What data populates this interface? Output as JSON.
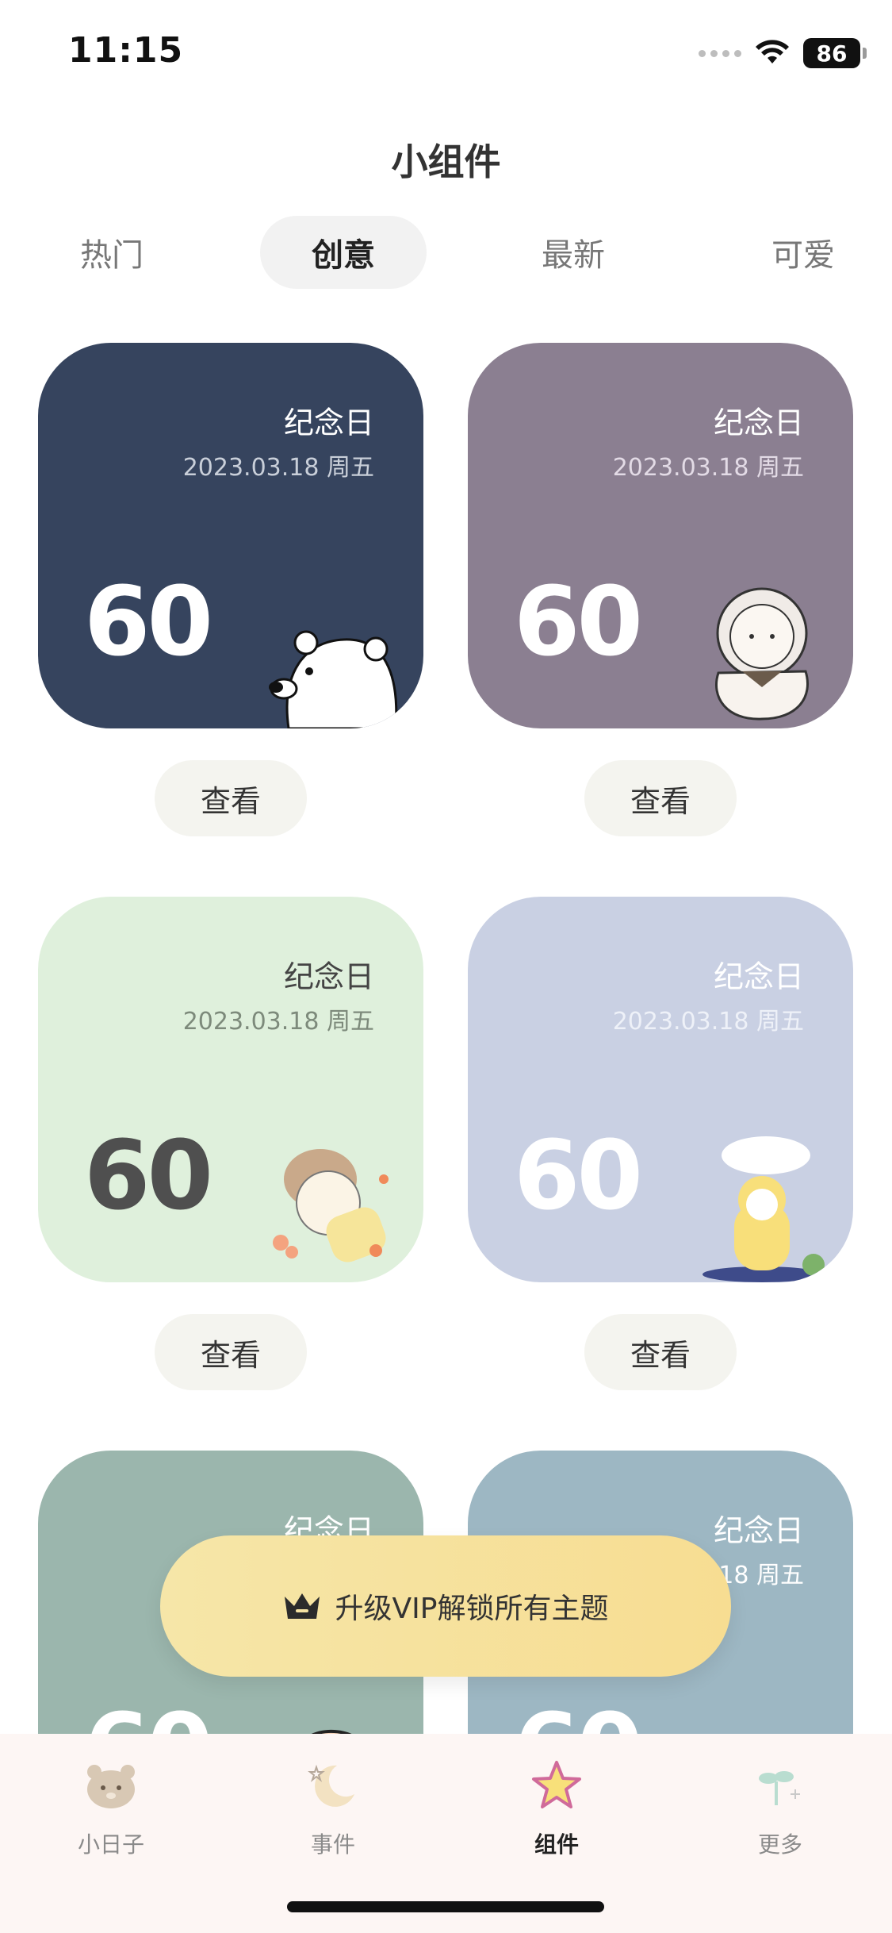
{
  "status_bar": {
    "time": "11:15",
    "battery": "86"
  },
  "page": {
    "title": "小组件"
  },
  "tabs": [
    {
      "label": "热门",
      "active": false
    },
    {
      "label": "创意",
      "active": true
    },
    {
      "label": "最新",
      "active": false
    },
    {
      "label": "可爱",
      "active": false
    }
  ],
  "widgets": [
    {
      "title": "纪念日",
      "date": "2023.03.18 周五",
      "number": "60",
      "button": "查看",
      "bg": "#36445e",
      "illustration": "polar-bear-icon"
    },
    {
      "title": "纪念日",
      "date": "2023.03.18 周五",
      "number": "60",
      "button": "查看",
      "bg": "#8b7f91",
      "illustration": "astronaut-bear-icon"
    },
    {
      "title": "纪念日",
      "date": "2023.03.18 周五",
      "number": "60",
      "button": "查看",
      "bg": "#dff0dc",
      "illustration": "sleeping-dog-icon"
    },
    {
      "title": "纪念日",
      "date": "2023.03.18 周五",
      "number": "60",
      "button": "查看",
      "bg": "#c9d0e3",
      "illustration": "rainy-bear-icon"
    },
    {
      "title": "纪念日",
      "date": "",
      "number": "60",
      "button": "",
      "bg": "#9bb6ad",
      "illustration": "boy-face-icon"
    },
    {
      "title": "纪念日",
      "date": ".18 周五",
      "number": "60",
      "button": "",
      "bg": "#9db7c3",
      "illustration": "small-creatures-icon"
    }
  ],
  "vip_banner": {
    "text": "升级VIP解锁所有主题",
    "icon": "crown-icon"
  },
  "bottom_nav": [
    {
      "label": "小日子",
      "icon": "bear-face-icon",
      "active": false
    },
    {
      "label": "事件",
      "icon": "moon-star-icon",
      "active": false
    },
    {
      "label": "组件",
      "icon": "star-icon",
      "active": true
    },
    {
      "label": "更多",
      "icon": "sprout-icon",
      "active": false
    }
  ]
}
